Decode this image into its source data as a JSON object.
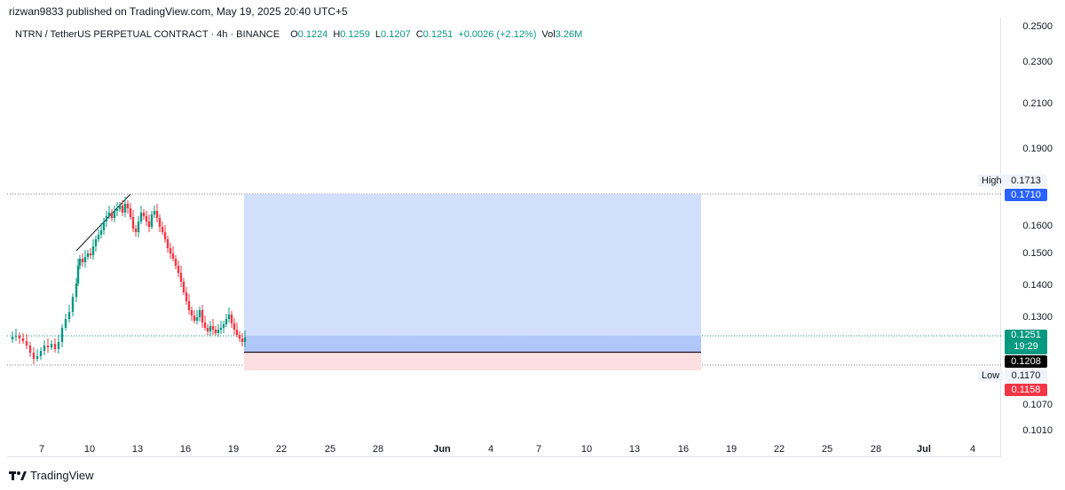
{
  "header": {
    "published": "rizwan9833 published on TradingView.com, May 19, 2025 20:40 UTC+5"
  },
  "legend": {
    "symbol": "NTRN / TetherUS PERPETUAL CONTRACT · 4h · BINANCE",
    "o_key": "O",
    "o_val": "0.1224",
    "h_key": "H",
    "h_val": "0.1259",
    "l_key": "L",
    "l_val": "0.1207",
    "c_key": "C",
    "c_val": "0.1251",
    "change": "+0.0026 (+2.12%)",
    "vol_key": "Vol",
    "vol_val": "3.26M"
  },
  "price_scale": {
    "ticks": [
      "0.2500",
      "0.2300",
      "0.2100",
      "0.1900",
      "0.1600",
      "0.1500",
      "0.1400",
      "0.1300",
      "0.1070",
      "0.1010"
    ]
  },
  "price_tags": {
    "high_label": "High",
    "high_value": "0.1713",
    "target": "0.1710",
    "last_price": "0.1251",
    "countdown": "19:29",
    "entry": "0.1208",
    "low_label": "Low",
    "low_value": "0.1170",
    "stop": "0.1158"
  },
  "colors": {
    "up": "#089981",
    "down": "#f23645",
    "target_zone": "#c6d6fb",
    "stop_zone": "#fbdfe1",
    "blue_tag": "#2962ff",
    "red_tag": "#f23645",
    "green_tag": "#089981"
  },
  "time_axis": {
    "labels": [
      "7",
      "10",
      "13",
      "16",
      "19",
      "22",
      "25",
      "28",
      "Jun",
      "4",
      "7",
      "10",
      "13",
      "16",
      "19",
      "22",
      "25",
      "28",
      "Jul",
      "4"
    ]
  },
  "brand": {
    "name": "TradingView"
  }
}
